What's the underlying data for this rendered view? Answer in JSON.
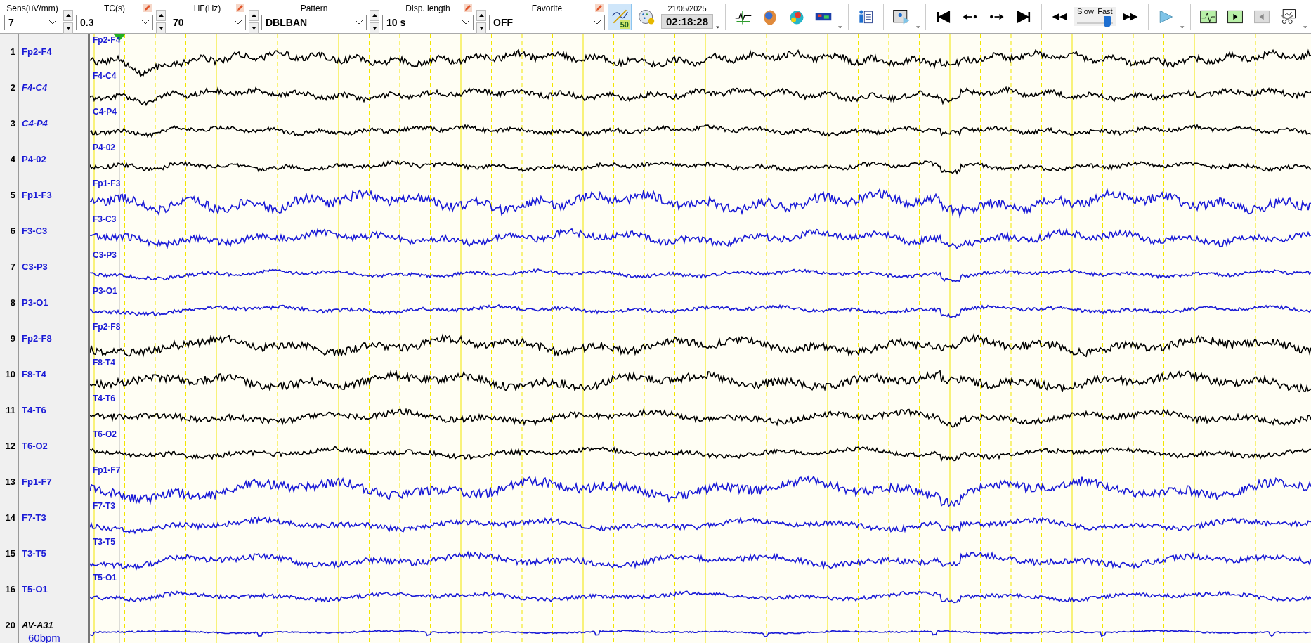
{
  "toolbar": {
    "controls": [
      {
        "label": "Sens(uV/mm)",
        "value": "7",
        "editable": false,
        "spin": true
      },
      {
        "label": "TC(s)",
        "value": "0.3",
        "editable": true,
        "spin": true
      },
      {
        "label": "HF(Hz)",
        "value": "70",
        "editable": true,
        "spin": true
      },
      {
        "label": "Pattern",
        "value": "DBLBAN",
        "editable": false,
        "spin": true
      },
      {
        "label": "Disp. length",
        "value": "10 s",
        "editable": true,
        "spin": true
      },
      {
        "label": "Favorite",
        "value": "OFF",
        "editable": true,
        "spin": false
      }
    ],
    "scale_button": {
      "badge": "50",
      "selected": true
    },
    "date": "21/05/2025",
    "time": "02:18:28",
    "speed": {
      "slow_label": "Slow",
      "fast_label": "Fast",
      "level": 0.85
    }
  },
  "channels": [
    {
      "number": "1",
      "label": "Fp2-F4",
      "trace_label": "Fp2-F4",
      "italic": false,
      "color": "#000000"
    },
    {
      "number": "2",
      "label": "F4-C4",
      "trace_label": "F4-C4",
      "italic": true,
      "color": "#000000"
    },
    {
      "number": "3",
      "label": "C4-P4",
      "trace_label": "C4-P4",
      "italic": true,
      "color": "#000000"
    },
    {
      "number": "4",
      "label": "P4-02",
      "trace_label": "P4-02",
      "italic": false,
      "color": "#000000"
    },
    {
      "number": "5",
      "label": "Fp1-F3",
      "trace_label": "Fp1-F3",
      "italic": false,
      "color": "#1a1ad6"
    },
    {
      "number": "6",
      "label": "F3-C3",
      "trace_label": "F3-C3",
      "italic": false,
      "color": "#1a1ad6"
    },
    {
      "number": "7",
      "label": "C3-P3",
      "trace_label": "C3-P3",
      "italic": false,
      "color": "#1a1ad6"
    },
    {
      "number": "8",
      "label": "P3-O1",
      "trace_label": "P3-O1",
      "italic": false,
      "color": "#1a1ad6"
    },
    {
      "number": "9",
      "label": "Fp2-F8",
      "trace_label": "Fp2-F8",
      "italic": false,
      "color": "#000000"
    },
    {
      "number": "10",
      "label": "F8-T4",
      "trace_label": "F8-T4",
      "italic": false,
      "color": "#000000"
    },
    {
      "number": "11",
      "label": "T4-T6",
      "trace_label": "T4-T6",
      "italic": false,
      "color": "#000000"
    },
    {
      "number": "12",
      "label": "T6-O2",
      "trace_label": "T6-O2",
      "italic": false,
      "color": "#000000"
    },
    {
      "number": "13",
      "label": "Fp1-F7",
      "trace_label": "Fp1-F7",
      "italic": false,
      "color": "#1a1ad6"
    },
    {
      "number": "14",
      "label": "F7-T3",
      "trace_label": "F7-T3",
      "italic": false,
      "color": "#1a1ad6"
    },
    {
      "number": "15",
      "label": "T3-T5",
      "trace_label": "T3-T5",
      "italic": false,
      "color": "#1a1ad6"
    },
    {
      "number": "16",
      "label": "T5-O1",
      "trace_label": "T5-O1",
      "italic": false,
      "color": "#1a1ad6"
    },
    {
      "number": "20",
      "label": "AV-A31",
      "italic": true,
      "color": "#1a1ad6",
      "sub": "60bpm"
    }
  ]
}
